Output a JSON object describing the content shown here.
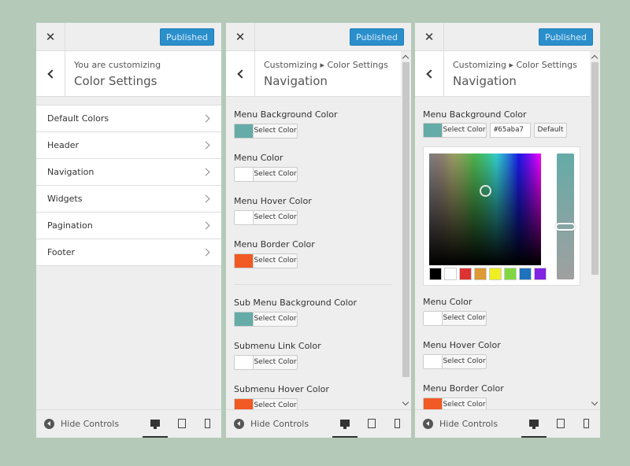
{
  "panel1": {
    "published_label": "Published",
    "header_sub": "You are customizing",
    "header_title": "Color Settings",
    "sections": [
      {
        "label": "Default Colors"
      },
      {
        "label": "Header"
      },
      {
        "label": "Navigation"
      },
      {
        "label": "Widgets"
      },
      {
        "label": "Pagination"
      },
      {
        "label": "Footer"
      }
    ],
    "footer": {
      "hide_label": "Hide Controls"
    }
  },
  "panel2": {
    "published_label": "Published",
    "breadcrumb": "Customizing ▸ Color Settings",
    "header_title": "Navigation",
    "controls": [
      {
        "label": "Menu Background Color",
        "button": "Select Color",
        "color": "#65aba7"
      },
      {
        "label": "Menu Color",
        "button": "Select Color",
        "color": "#ffffff"
      },
      {
        "label": "Menu Hover Color",
        "button": "Select Color",
        "color": "#ffffff"
      },
      {
        "label": "Menu Border Color",
        "button": "Select Color",
        "color": "#f15a24"
      },
      {
        "label": "Sub Menu Background Color",
        "button": "Select Color",
        "color": "#65aba7"
      },
      {
        "label": "Submenu Link Color",
        "button": "Select Color",
        "color": "#ffffff"
      },
      {
        "label": "Submenu Hover Color",
        "button": "Select Color",
        "color": "#f15a24"
      }
    ],
    "footer": {
      "hide_label": "Hide Controls"
    }
  },
  "panel3": {
    "published_label": "Published",
    "breadcrumb": "Customizing ▸ Color Settings",
    "header_title": "Navigation",
    "picker_control": {
      "label": "Menu Background Color",
      "button": "Select Color",
      "color": "#65aba7",
      "hex_value": "#65aba7",
      "default_label": "Default",
      "palette": [
        "#000000",
        "#ffffff",
        "#dd3333",
        "#dd9933",
        "#eeee22",
        "#81d742",
        "#1e73be",
        "#8224e3"
      ]
    },
    "controls": [
      {
        "label": "Menu Color",
        "button": "Select Color",
        "color": "#ffffff"
      },
      {
        "label": "Menu Hover Color",
        "button": "Select Color",
        "color": "#ffffff"
      },
      {
        "label": "Menu Border Color",
        "button": "Select Color",
        "color": "#f15a24"
      }
    ],
    "footer": {
      "hide_label": "Hide Controls"
    }
  },
  "colors": {
    "accent": "#2b8fcc",
    "teal": "#65aba7",
    "orange": "#f15a24",
    "background": "#b5c9b9"
  },
  "icons": {
    "close": "close-icon",
    "back": "chevron-left-icon",
    "section_arrow": "chevron-right-icon",
    "hide": "arrow-left-circle-icon",
    "desktop": "desktop-icon",
    "tablet": "tablet-icon",
    "mobile": "mobile-icon"
  }
}
